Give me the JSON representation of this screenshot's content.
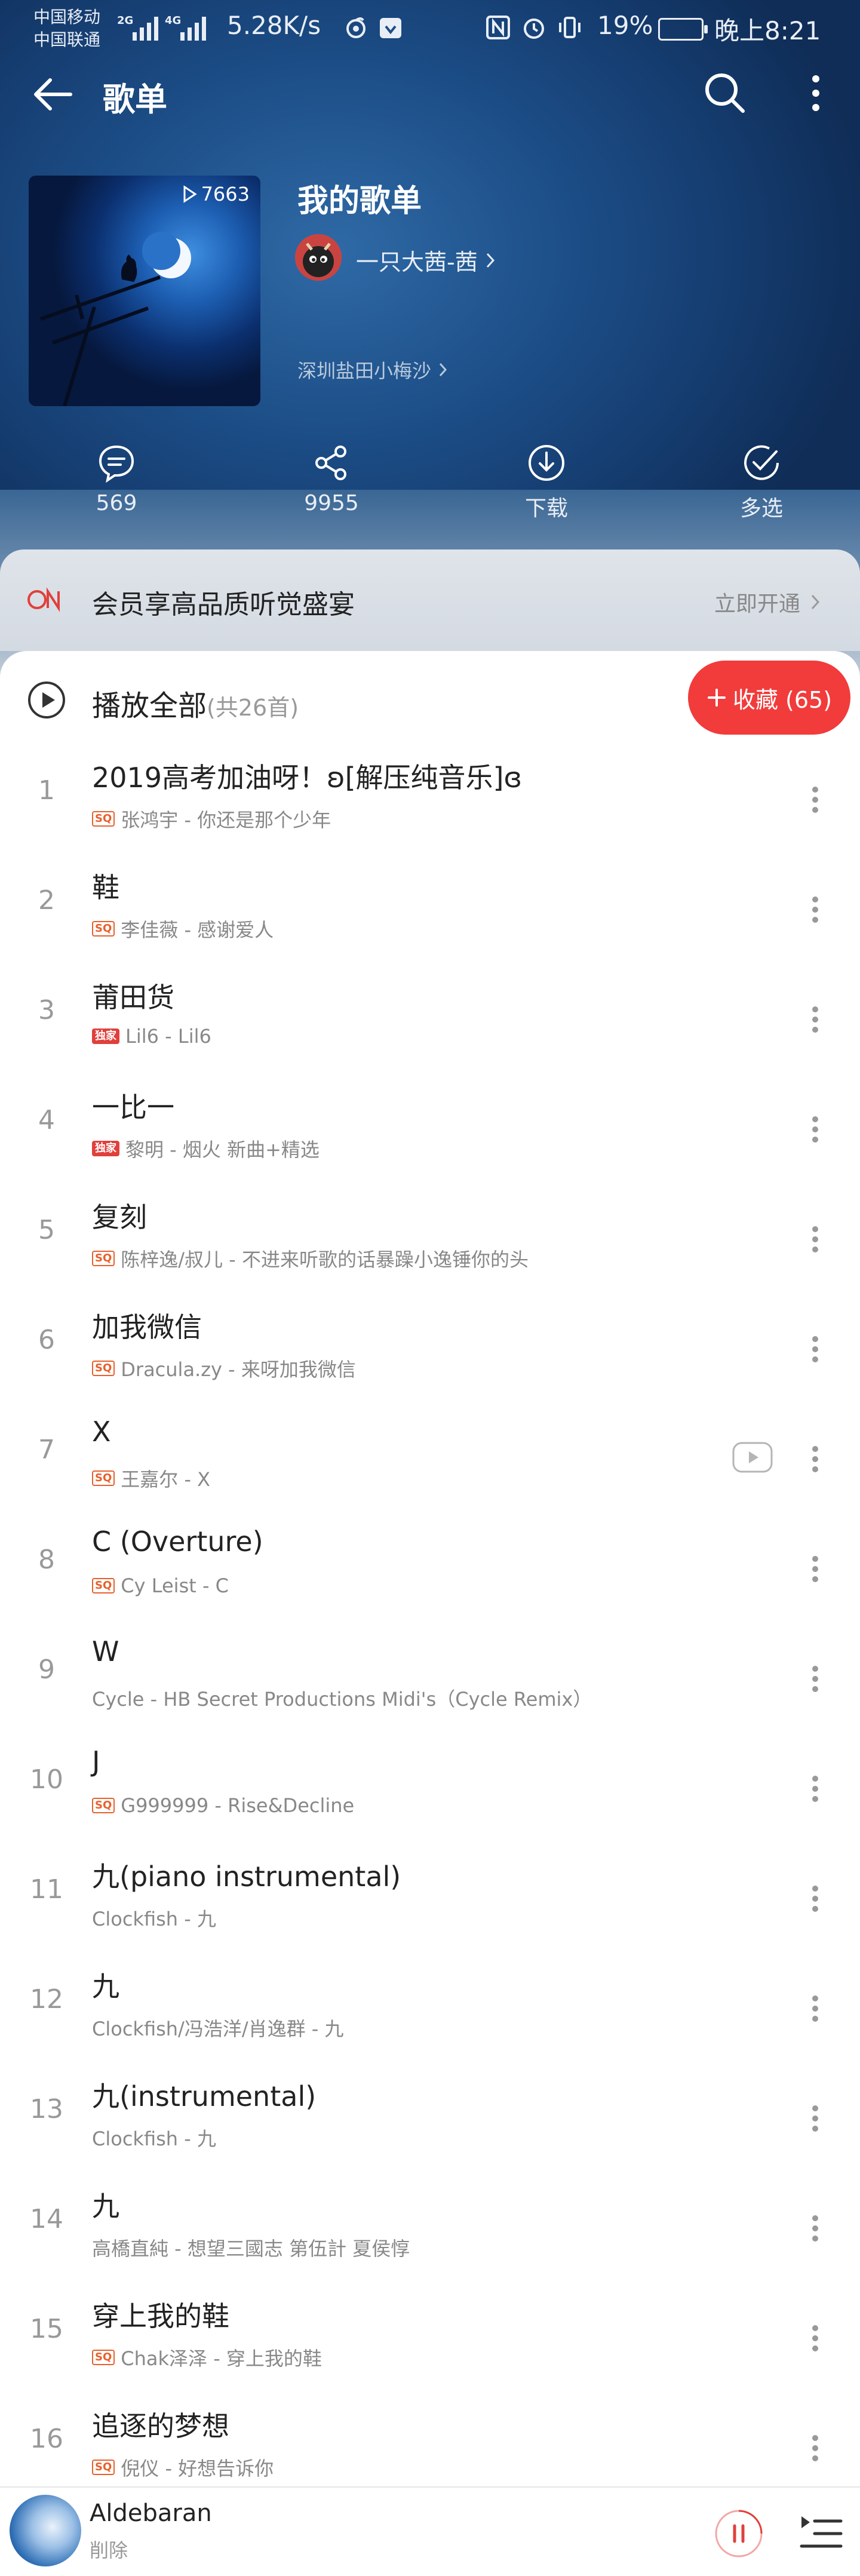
{
  "status_bar": {
    "carrier_1": "中国移动",
    "carrier_2": "中国联通",
    "net_1": "2G",
    "net_2": "4G",
    "speed": "5.28K/s",
    "battery": "19%",
    "time": "晚上8:21"
  },
  "topbar": {
    "title": "歌单"
  },
  "playlist": {
    "play_count": "7663",
    "title": "我的歌单",
    "owner": "一只大茜-茜",
    "description": "深圳盐田小梅沙"
  },
  "actions": [
    {
      "label": "569",
      "icon": "comment-icon"
    },
    {
      "label": "9955",
      "icon": "share-icon"
    },
    {
      "label": "下载",
      "icon": "download-icon"
    },
    {
      "label": "多选",
      "icon": "multi-select-icon"
    }
  ],
  "vip": {
    "text": "会员享高品质听觉盛宴",
    "link": "立即开通"
  },
  "play_all": {
    "label": "播放全部",
    "count": "(共26首)",
    "collect": "收藏 (65)"
  },
  "songs": [
    {
      "index": "1",
      "title": "2019高考加油呀！ʚ[解压纯音乐]ɞ",
      "badge": "SQ",
      "subtitle": "张鸿宇 - 你还是那个少年"
    },
    {
      "index": "2",
      "title": "鞋",
      "badge": "SQ",
      "subtitle": "李佳薇 - 感谢爱人"
    },
    {
      "index": "3",
      "title": "莆田货",
      "badge": "独家",
      "subtitle": "Lil6 - Lil6"
    },
    {
      "index": "4",
      "title": "一比一",
      "badge": "独家",
      "subtitle": "黎明 - 烟火 新曲+精选"
    },
    {
      "index": "5",
      "title": "复刻",
      "badge": "SQ",
      "subtitle": "陈梓逸/叔儿 - 不进来听歌的话暴躁小逸锤你的头"
    },
    {
      "index": "6",
      "title": "加我微信",
      "badge": "SQ",
      "subtitle": "Dracula.zy - 来呀加我微信"
    },
    {
      "index": "7",
      "title": "X",
      "badge": "SQ",
      "subtitle": "王嘉尔 - X",
      "mv": true
    },
    {
      "index": "8",
      "title": "C (Overture)",
      "badge": "SQ",
      "subtitle": "Cy Leist - C"
    },
    {
      "index": "9",
      "title": "W",
      "badge": "",
      "subtitle": "Cycle - HB Secret Productions Midi's（Cycle Remix）"
    },
    {
      "index": "10",
      "title": "J",
      "badge": "SQ",
      "subtitle": "G999999 - Rise&Decline"
    },
    {
      "index": "11",
      "title": "九(piano instrumental)",
      "badge": "",
      "subtitle": "Clockfish - 九"
    },
    {
      "index": "12",
      "title": "九",
      "badge": "",
      "subtitle": "Clockfish/冯浩洋/肖逸群 - 九"
    },
    {
      "index": "13",
      "title": "九(instrumental)",
      "badge": "",
      "subtitle": "Clockfish - 九"
    },
    {
      "index": "14",
      "title": "九",
      "badge": "",
      "subtitle": "高橋直純 - 想望三國志 第伍計 夏侯惇"
    },
    {
      "index": "15",
      "title": "穿上我的鞋",
      "badge": "SQ",
      "subtitle": "Chak泽泽 - 穿上我的鞋"
    },
    {
      "index": "16",
      "title": "追逐的梦想",
      "badge": "SQ",
      "subtitle": "倪仪 - 好想告诉你"
    }
  ],
  "player": {
    "title": "Aldebaran",
    "subtitle": "削除"
  },
  "colors": {
    "accent_red": "#f23b3b",
    "hero_blue": "#1c4d86",
    "badge_orange": "#e8602c"
  }
}
